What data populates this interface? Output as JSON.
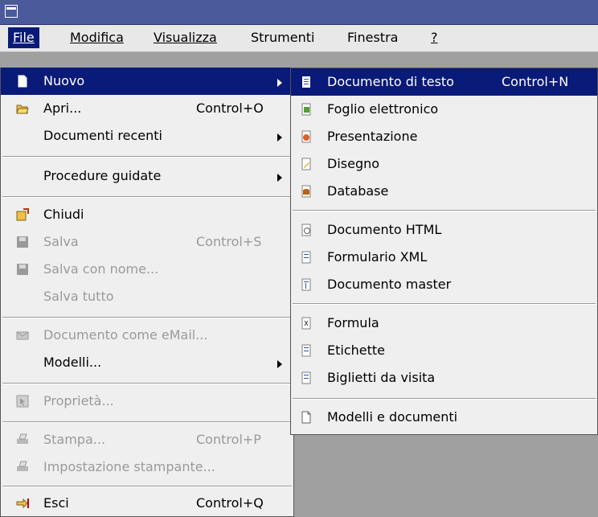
{
  "menubar": {
    "items": [
      {
        "label": "File",
        "active": true
      },
      {
        "label": "Modifica"
      },
      {
        "label": "Visualizza"
      },
      {
        "label": "Strumenti"
      },
      {
        "label": "Finestra"
      },
      {
        "label": "?"
      }
    ]
  },
  "file_menu": {
    "nuovo": "Nuovo",
    "apri": "Apri...",
    "apri_accel": "Control+O",
    "recenti": "Documenti recenti",
    "procedure": "Procedure guidate",
    "chiudi": "Chiudi",
    "salva": "Salva",
    "salva_accel": "Control+S",
    "salva_nome": "Salva con nome...",
    "salva_tutto": "Salva tutto",
    "email": "Documento come eMail...",
    "modelli": "Modelli...",
    "proprieta": "Proprietà...",
    "stampa": "Stampa...",
    "stampa_accel": "Control+P",
    "impostazione": "Impostazione stampante...",
    "esci": "Esci",
    "esci_accel": "Control+Q"
  },
  "new_menu": {
    "testo": "Documento di testo",
    "testo_accel": "Control+N",
    "foglio": "Foglio elettronico",
    "presentazione": "Presentazione",
    "disegno": "Disegno",
    "database": "Database",
    "html": "Documento HTML",
    "xml": "Formulario XML",
    "master": "Documento master",
    "formula": "Formula",
    "etichette": "Etichette",
    "biglietti": "Biglietti da visita",
    "modelli_doc": "Modelli e documenti"
  },
  "colors": {
    "highlight": "#0a1a78",
    "titlebar": "#4a5a9a",
    "menu_bg": "#efefef",
    "disabled_text": "#9a9a9a"
  }
}
